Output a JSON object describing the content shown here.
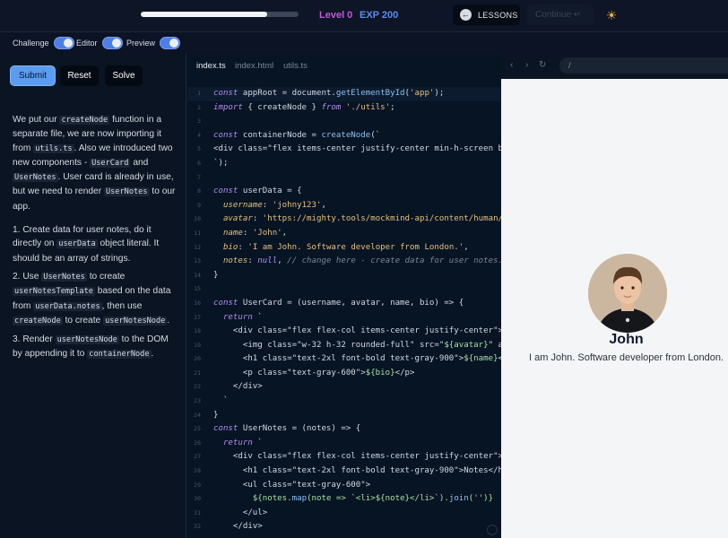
{
  "topbar": {
    "progress_fraction": 0.8,
    "level": "Level 0",
    "exp": "EXP 200",
    "lessons_label": "LESSONS",
    "continue_label": "Continue ↵"
  },
  "toggles": {
    "challenge": "Challenge",
    "editor": "Editor",
    "preview": "Preview"
  },
  "actions": {
    "submit": "Submit",
    "reset": "Reset",
    "solve": "Solve"
  },
  "instructions": {
    "intro": [
      "We put our ",
      "createNode",
      " function in a separate file, we are now importing it from ",
      "utils.ts",
      ". Also we introduced two new components - ",
      "UserCard",
      " and ",
      "UserNotes",
      ". User card is already in use, but we need to render ",
      "UserNotes",
      " to our app."
    ],
    "steps": [
      [
        "1. Create data for user notes, do it directly on ",
        "userData",
        " object literal. It should be an array of strings."
      ],
      [
        "2. Use ",
        "UserNotes",
        " to create ",
        "userNotesTemplate",
        " based on the data from ",
        "userData.notes",
        ", then use ",
        "createNode",
        " to create ",
        "userNotesNode",
        "."
      ],
      [
        "3. Render ",
        "userNotesNode",
        " to the DOM by appending it to ",
        "containerNode",
        "."
      ]
    ]
  },
  "editor": {
    "tabs": [
      "index.ts",
      "index.html",
      "utils.ts"
    ],
    "lines": [
      [
        [
          "kw",
          "const"
        ],
        [
          "t",
          " appRoot = document."
        ],
        [
          "fn",
          "getElementById"
        ],
        [
          "t",
          "("
        ],
        [
          "str",
          "'app'"
        ],
        [
          "t",
          ");"
        ]
      ],
      [
        [
          "kw",
          "import"
        ],
        [
          "t",
          " { createNode } "
        ],
        [
          "kw",
          "from"
        ],
        [
          "t",
          " "
        ],
        [
          "str",
          "'./utils'"
        ],
        [
          "t",
          ";"
        ]
      ],
      [],
      [
        [
          "kw",
          "const"
        ],
        [
          "t",
          " containerNode = "
        ],
        [
          "fn",
          "createNode"
        ],
        [
          "t",
          "(`"
        ]
      ],
      [
        [
          "t",
          "<div class=\"flex items-center justify-center min-h-screen bg-"
        ]
      ],
      [
        [
          "t",
          "`);"
        ]
      ],
      [],
      [
        [
          "kw",
          "const"
        ],
        [
          "t",
          " userData = {"
        ]
      ],
      [
        [
          "t",
          "  "
        ],
        [
          "prop",
          "username"
        ],
        [
          "t",
          ": "
        ],
        [
          "str",
          "'johny123'"
        ],
        [
          "t",
          ","
        ]
      ],
      [
        [
          "t",
          "  "
        ],
        [
          "prop",
          "avatar"
        ],
        [
          "t",
          ": "
        ],
        [
          "str",
          "'https://mighty.tools/mockmind-api/content/human/5"
        ]
      ],
      [
        [
          "t",
          "  "
        ],
        [
          "prop",
          "name"
        ],
        [
          "t",
          ": "
        ],
        [
          "str",
          "'John'"
        ],
        [
          "t",
          ","
        ]
      ],
      [
        [
          "t",
          "  "
        ],
        [
          "prop",
          "bio"
        ],
        [
          "t",
          ": "
        ],
        [
          "str",
          "'I am John. Software developer from London.'"
        ],
        [
          "t",
          ","
        ]
      ],
      [
        [
          "t",
          "  "
        ],
        [
          "prop",
          "notes"
        ],
        [
          "t",
          ": "
        ],
        [
          "kw",
          "null"
        ],
        [
          "t",
          ", "
        ],
        [
          "cm",
          "// change here - create data for user notes. "
        ]
      ],
      [
        [
          "t",
          "}"
        ]
      ],
      [],
      [
        [
          "kw",
          "const"
        ],
        [
          "t",
          " UserCard = (username, avatar, name, bio) => {"
        ]
      ],
      [
        [
          "t",
          "  "
        ],
        [
          "kw",
          "return"
        ],
        [
          "t",
          " `"
        ]
      ],
      [
        [
          "t",
          "    <div class=\"flex flex-col items-center justify-center\">"
        ]
      ],
      [
        [
          "t",
          "      <img class=\"w-32 h-32 rounded-full\" src=\""
        ],
        [
          "tpl",
          "${avatar}"
        ],
        [
          "t",
          "\" al"
        ]
      ],
      [
        [
          "t",
          "      <h1 class=\"text-2xl font-bold text-gray-900\">"
        ],
        [
          "tpl",
          "${name}"
        ],
        [
          "t",
          "</"
        ]
      ],
      [
        [
          "t",
          "      <p class=\"text-gray-600\">"
        ],
        [
          "tpl",
          "${bio}"
        ],
        [
          "t",
          "</p>"
        ]
      ],
      [
        [
          "t",
          "    </div>"
        ]
      ],
      [
        [
          "t",
          "  `"
        ]
      ],
      [
        [
          "t",
          "}"
        ]
      ],
      [
        [
          "kw",
          "const"
        ],
        [
          "t",
          " UserNotes = (notes) => {"
        ]
      ],
      [
        [
          "t",
          "  "
        ],
        [
          "kw",
          "return"
        ],
        [
          "t",
          " `"
        ]
      ],
      [
        [
          "t",
          "    <div class=\"flex flex-col items-center justify-center\">"
        ]
      ],
      [
        [
          "t",
          "      <h1 class=\"text-2xl font-bold text-gray-900\">Notes</h1"
        ]
      ],
      [
        [
          "t",
          "      <ul class=\"text-gray-600\">"
        ]
      ],
      [
        [
          "t",
          "        "
        ],
        [
          "tpl",
          "${notes."
        ],
        [
          "fn",
          "map"
        ],
        [
          "tpl",
          "(note => `<li>${note}</li>`)."
        ],
        [
          "fn",
          "join"
        ],
        [
          "tpl",
          "('')}"
        ]
      ],
      [
        [
          "t",
          "      </ul>"
        ]
      ],
      [
        [
          "t",
          "    </div>"
        ]
      ]
    ]
  },
  "preview": {
    "url": "/",
    "name": "John",
    "bio": "I am John. Software developer from London."
  }
}
